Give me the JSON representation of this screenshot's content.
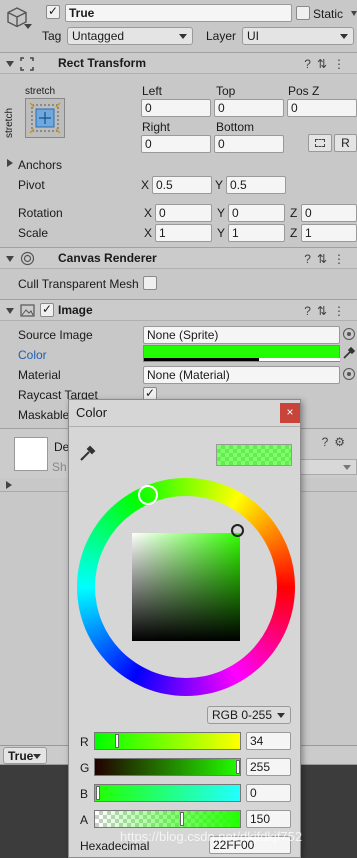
{
  "object_header": {
    "name": "True",
    "static_label": "Static",
    "tag_label": "Tag",
    "tag_value": "Untagged",
    "layer_label": "Layer",
    "layer_value": "UI"
  },
  "rect_transform": {
    "title": "Rect Transform",
    "anchor_top_label": "stretch",
    "anchor_side_label": "stretch",
    "left_label": "Left",
    "left_value": "0",
    "top_label": "Top",
    "top_value": "0",
    "posz_label": "Pos Z",
    "posz_value": "0",
    "right_label": "Right",
    "right_value": "0",
    "bottom_label": "Bottom",
    "bottom_value": "0",
    "r_button": "R",
    "anchors_label": "Anchors",
    "pivot_label": "Pivot",
    "pivot_x_label": "X",
    "pivot_x": "0.5",
    "pivot_y_label": "Y",
    "pivot_y": "0.5",
    "rotation_label": "Rotation",
    "rot_x_label": "X",
    "rot_x": "0",
    "rot_y_label": "Y",
    "rot_y": "0",
    "rot_z_label": "Z",
    "rot_z": "0",
    "scale_label": "Scale",
    "scale_x_label": "X",
    "scale_x": "1",
    "scale_y_label": "Y",
    "scale_y": "1",
    "scale_z_label": "Z",
    "scale_z": "1"
  },
  "canvas_renderer": {
    "title": "Canvas Renderer",
    "cull_label": "Cull Transparent Mesh"
  },
  "image": {
    "title": "Image",
    "source_image_label": "Source Image",
    "source_image_value": "None (Sprite)",
    "color_label": "Color",
    "color_value": "#22FF00",
    "material_label": "Material",
    "material_value": "None (Material)",
    "raycast_label": "Raycast Target",
    "maskable_label": "Maskable"
  },
  "material_preview": {
    "name_partial": "De",
    "shader_partial": "Sh"
  },
  "bottom_bar": {
    "dropdown_value": "True"
  },
  "color_picker": {
    "title": "Color",
    "close_icon": "×",
    "mode": "RGB 0-255",
    "r_label": "R",
    "r_value": "34",
    "g_label": "G",
    "g_value": "255",
    "b_label": "B",
    "b_value": "0",
    "a_label": "A",
    "a_value": "150",
    "hex_label": "Hexadecimal",
    "hex_value": "22FF00",
    "colors": {
      "current": "#22FF00",
      "hue": "#33ff00"
    }
  },
  "watermark": "https://blog.csdn.net/dkjfdkjf752"
}
